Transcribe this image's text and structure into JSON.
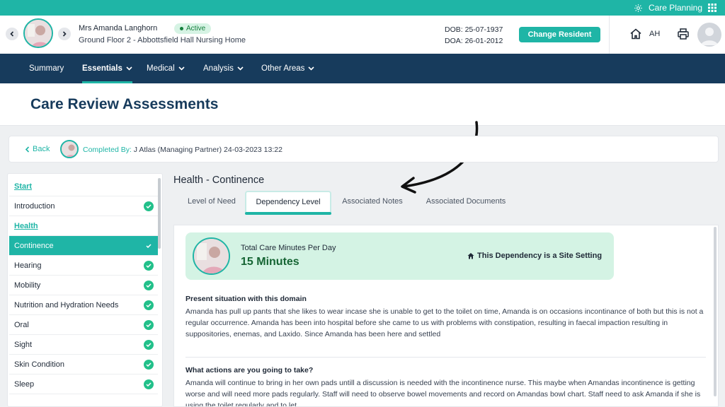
{
  "topbar": {
    "app_label": "Care Planning",
    "settings_icon": "gear-icon",
    "grid_icon": "grid-icon"
  },
  "resident": {
    "name": "Mrs Amanda Langhorn",
    "status": "Active",
    "location": "Ground Floor 2 - Abbottsfield Hall Nursing Home",
    "dob": "DOB: 25-07-1937",
    "doa": "DOA: 26-01-2012",
    "change_label": "Change Resident",
    "user_initials": "AH"
  },
  "nav": [
    {
      "label": "Summary"
    },
    {
      "label": "Essentials"
    },
    {
      "label": "Medical"
    },
    {
      "label": "Analysis"
    },
    {
      "label": "Other Areas"
    }
  ],
  "page": {
    "title": "Care Review Assessments",
    "back_label": "Back",
    "completed_label": "Completed By:",
    "completed_value": "J Atlas (Managing Partner) 24-03-2023 13:22"
  },
  "sidebar": [
    {
      "label": "Start"
    },
    {
      "label": "Introduction"
    },
    {
      "label": "Health"
    },
    {
      "label": "Continence"
    },
    {
      "label": "Hearing"
    },
    {
      "label": "Mobility"
    },
    {
      "label": "Nutrition and Hydration Needs"
    },
    {
      "label": "Oral"
    },
    {
      "label": "Sight"
    },
    {
      "label": "Skin Condition"
    },
    {
      "label": "Sleep"
    }
  ],
  "content": {
    "section_title": "Health - Continence",
    "tabs": [
      {
        "label": "Level of Need"
      },
      {
        "label": "Dependency Level"
      },
      {
        "label": "Associated Notes"
      },
      {
        "label": "Associated Documents"
      }
    ],
    "summary": {
      "label": "Total Care Minutes Per Day",
      "value": "15 Minutes",
      "site_setting": "This Dependency is a Site Setting"
    },
    "questions": [
      {
        "title": "Present situation with this domain",
        "text": "Amanda has pull up pants that she likes to wear incase she is unable to get to the toilet on time, Amanda is on occasions incontinance of both but this is not a regular occurrence. Amanda has been into hospital before she came to us with problems with constipation, resulting in faecal impaction resulting in suppositories, enemas, and Laxido. Since Amanda has been here and settled"
      },
      {
        "title": "What actions are you going to take?",
        "text": "Amanda will continue to bring in her own pads untill a discussion is needed with the incontinence nurse. This maybe when Amandas incontinence is getting worse and will need more pads regularly. Staff will need to observe bowel movements and record on Amandas bowl chart. Staff need to ask Amanda if she is using the toilet regularly and to let"
      }
    ]
  }
}
